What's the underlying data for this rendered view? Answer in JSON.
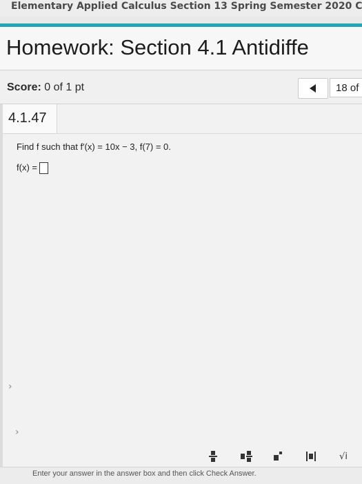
{
  "course": {
    "title": "Elementary Applied Calculus Section 13 Spring Semester 2020 C"
  },
  "homework": {
    "title": "Homework: Section 4.1 Antidiffe"
  },
  "score": {
    "label": "Score:",
    "value": "0 of 1 pt"
  },
  "navigation": {
    "question_counter": "18 of"
  },
  "question": {
    "number": "4.1.47",
    "prompt": "Find f such that f′(x) = 10x − 3, f(7) = 0.",
    "answer_label": "f(x) ="
  },
  "toolbar": {
    "icons": [
      "fraction-icon",
      "mixed-number-icon",
      "exponent-icon",
      "absolute-value-icon",
      "square-root-icon"
    ],
    "sqrt_glyph": "√i"
  },
  "footer": {
    "instruction": "Enter your answer in the answer box and then click Check Answer."
  },
  "colors": {
    "accent_teal": "#22a7b5",
    "background": "#f2f2f2"
  }
}
